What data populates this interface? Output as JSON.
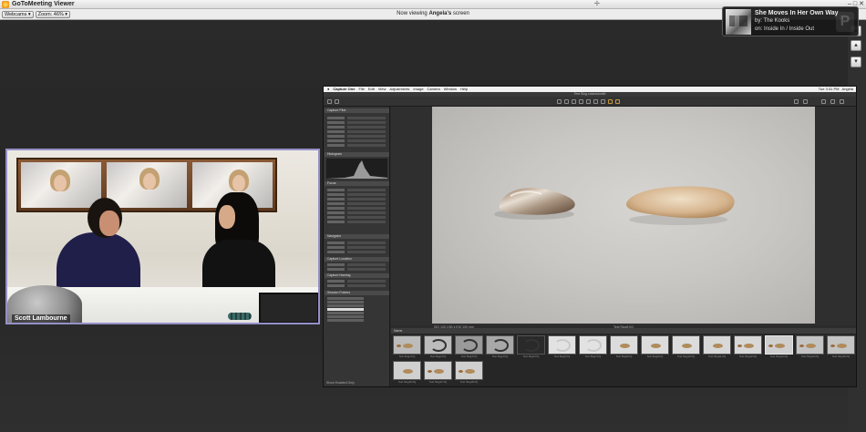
{
  "window": {
    "title": "GoToMeeting Viewer",
    "controls": [
      "–",
      "□",
      "✕"
    ]
  },
  "toolbar": {
    "webcams_label": "Webcams ▾",
    "zoom_label": "Zoom: 46% ▾",
    "viewing_prefix": "Now viewing ",
    "viewing_name": "Angela's",
    "viewing_suffix": " screen"
  },
  "scroll_buttons": [
    "▴",
    "▴",
    "▾"
  ],
  "now_playing": {
    "song": "She Moves In Her Own Way",
    "artist_line": "by: The Kooks",
    "album_line": "on: Inside In / Inside Out",
    "badge": "P"
  },
  "webcam": {
    "presenter_name": "Scott Lambourne"
  },
  "shared_screen": {
    "menubar": [
      "Capture One",
      "File",
      "Edit",
      "View",
      "Adjustments",
      "Image",
      "Camera",
      "Window",
      "Help"
    ],
    "status": [
      "Tue 3:31 PM",
      "Angela"
    ],
    "window_title": "Test Slug.cosessiondb",
    "panels": [
      "Capture Pilot",
      "Histogram",
      "Focus",
      "Navigator",
      "Capture Location",
      "Capture Naming",
      "Session Folders"
    ],
    "viewer_left_caption": "ISO 100  1/50 s  f/10  100 mm",
    "viewer_center_caption": "Test Slug9.IIQ",
    "filmstrip_label": "Name",
    "thumb_labels": [
      "Test Slug1.IIQ",
      "Test Slug2.IIQ",
      "Test Slug3.IIQ",
      "Test Slug4.IIQ",
      "Test Slug5.IIQ",
      "Test Slug6.IIQ",
      "Test Slug7.IIQ",
      "Test Slug8.IIQ",
      "Test Slug9.IIQ",
      "Test Slug10.IIQ",
      "Test Slug11.IIQ",
      "Test Slug12.IIQ",
      "Test Slug13.IIQ",
      "Test Slug14.IIQ",
      "Test Slug15.IIQ",
      "Test Slug16.IIQ",
      "Test Slug17.IIQ",
      "Test Slug18.IIQ"
    ],
    "bottom_label": "Show Enabled Only"
  }
}
